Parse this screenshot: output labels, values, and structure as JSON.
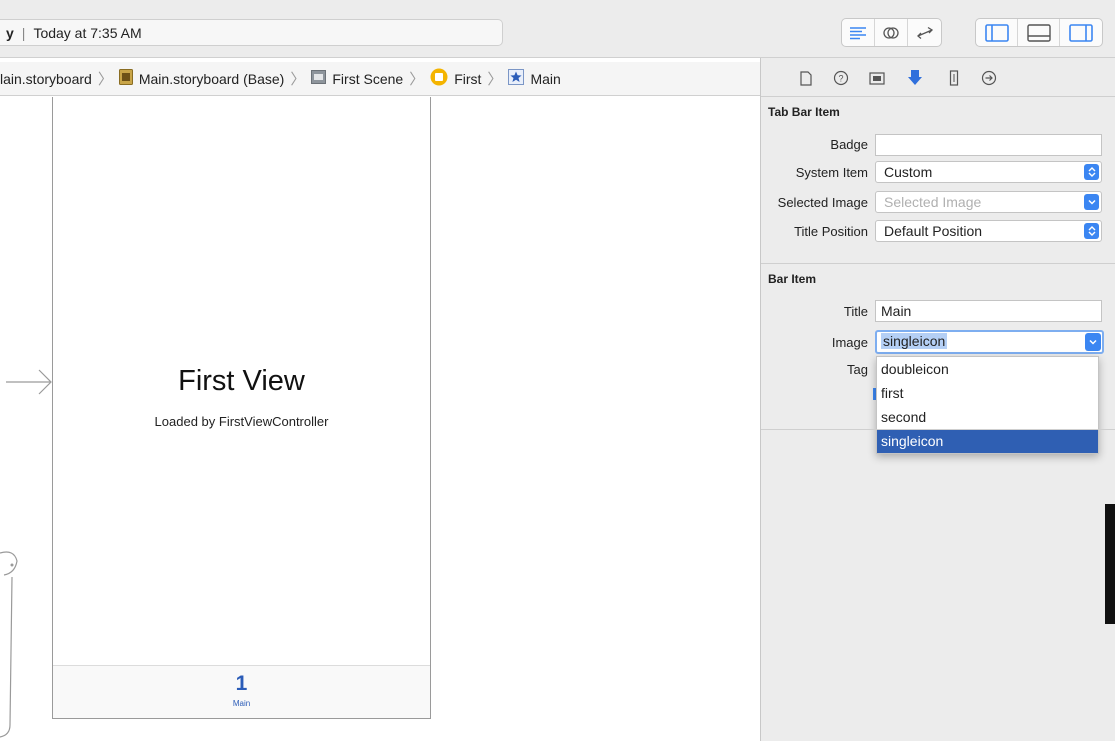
{
  "toolbar": {
    "project_fragment": "y",
    "status_text": "Today at 7:35 AM",
    "editor_icons": [
      "standard-editor-icon",
      "assistant-editor-icon",
      "version-editor-icon"
    ],
    "view_icons": [
      "navigator-toggle-icon",
      "debug-area-toggle-icon",
      "utilities-toggle-icon"
    ]
  },
  "jumpbar": {
    "crumbs": [
      {
        "label": "Main.storyboard",
        "icon": "storyboard-file-icon",
        "display": "lain.storyboard"
      },
      {
        "label": "Main.storyboard (Base)",
        "icon": "storyboard-base-icon"
      },
      {
        "label": "First Scene",
        "icon": "scene-icon"
      },
      {
        "label": "First",
        "icon": "view-controller-icon"
      },
      {
        "label": "Main",
        "icon": "tab-bar-item-icon"
      }
    ]
  },
  "canvas": {
    "view_title": "First View",
    "view_subtitle": "Loaded by FirstViewController",
    "tab_item": {
      "glyph": "1",
      "label": "Main"
    }
  },
  "inspector": {
    "tabs": [
      "file-inspector-icon",
      "quick-help-icon",
      "identity-inspector-icon",
      "attributes-inspector-icon",
      "size-inspector-icon",
      "connections-inspector-icon"
    ],
    "tab_bar_item": {
      "title": "Tab Bar Item",
      "badge_label": "Badge",
      "badge_value": "",
      "system_item_label": "System Item",
      "system_item_value": "Custom",
      "selected_image_label": "Selected Image",
      "selected_image_placeholder": "Selected Image",
      "title_position_label": "Title Position",
      "title_position_value": "Default Position"
    },
    "bar_item": {
      "title": "Bar Item",
      "title_label": "Title",
      "title_value": "Main",
      "image_label": "Image",
      "image_value": "singleicon",
      "tag_label": "Tag",
      "image_options": [
        "doubleicon",
        "first",
        "second",
        "singleicon"
      ],
      "selected_option": "singleicon"
    }
  },
  "colors": {
    "accent": "#3b86f2",
    "selection": "#2f5fb3",
    "tab_tint": "#2b5cb8"
  }
}
